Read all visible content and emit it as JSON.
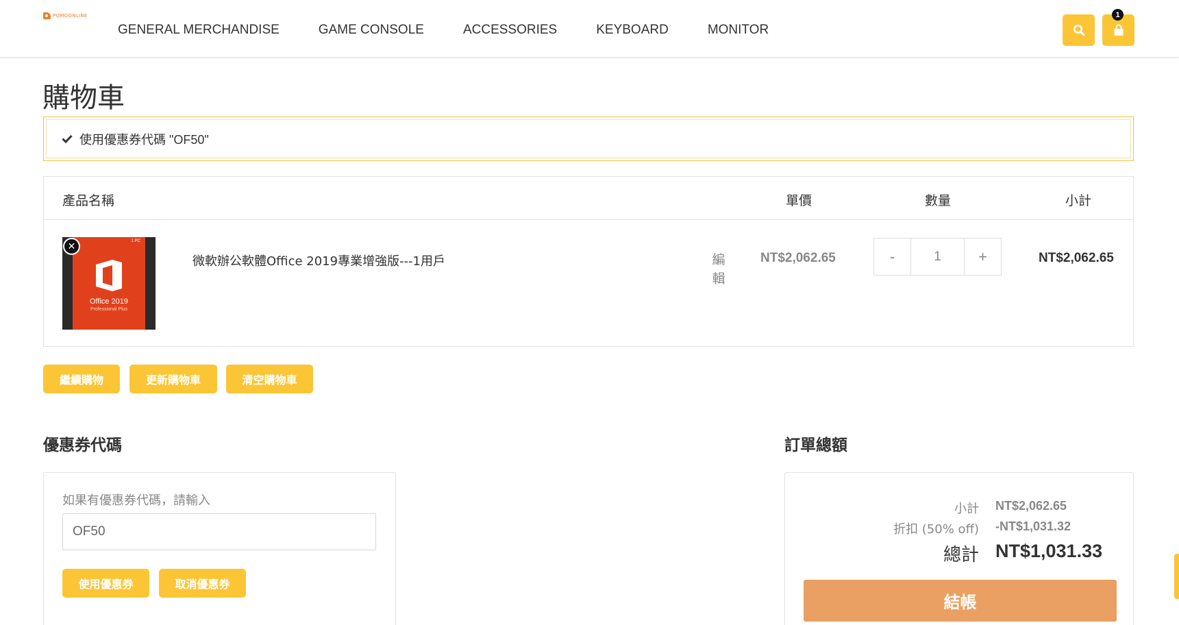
{
  "brand": {
    "logo_text": "POMOONLINE",
    "accent": "#fbc536",
    "checkout_color": "#e9a062"
  },
  "nav": {
    "items": [
      "GENERAL MERCHANDISE",
      "GAME CONSOLE",
      "ACCESSORIES",
      "KEYBOARD",
      "MONITOR"
    ]
  },
  "header": {
    "search_icon": "search-icon",
    "cart_icon": "bag-icon",
    "cart_count": "1"
  },
  "page": {
    "title": "購物車"
  },
  "notice": {
    "text": "使用優惠券代碼 \"OF50\""
  },
  "cart": {
    "headers": {
      "product": "產品名稱",
      "price": "單價",
      "qty": "數量",
      "subtotal": "小計"
    },
    "items": [
      {
        "image": {
          "badge": "1 PC",
          "name": "Office 2019",
          "sub": "Professional Plus"
        },
        "name": "微軟辦公軟體Office 2019專業增強版---1用戶",
        "edit_label": "編輯",
        "price": "NT$2,062.65",
        "qty": "1",
        "minus": "-",
        "plus": "+",
        "subtotal": "NT$2,062.65"
      }
    ]
  },
  "actions": {
    "continue": "繼續購物",
    "update": "更新購物車",
    "clear": "清空購物車"
  },
  "coupon": {
    "title": "優惠券代碼",
    "label": "如果有優惠券代碼，請輸入",
    "value": "OF50",
    "apply": "使用優惠券",
    "cancel": "取消優惠券"
  },
  "totals": {
    "title": "訂單總額",
    "subtotal_label": "小計",
    "subtotal_value": "NT$2,062.65",
    "discount_label": "折扣 (50% off)",
    "discount_value": "-NT$1,031.32",
    "total_label": "總計",
    "total_value": "NT$1,031.33",
    "checkout": "結帳"
  }
}
